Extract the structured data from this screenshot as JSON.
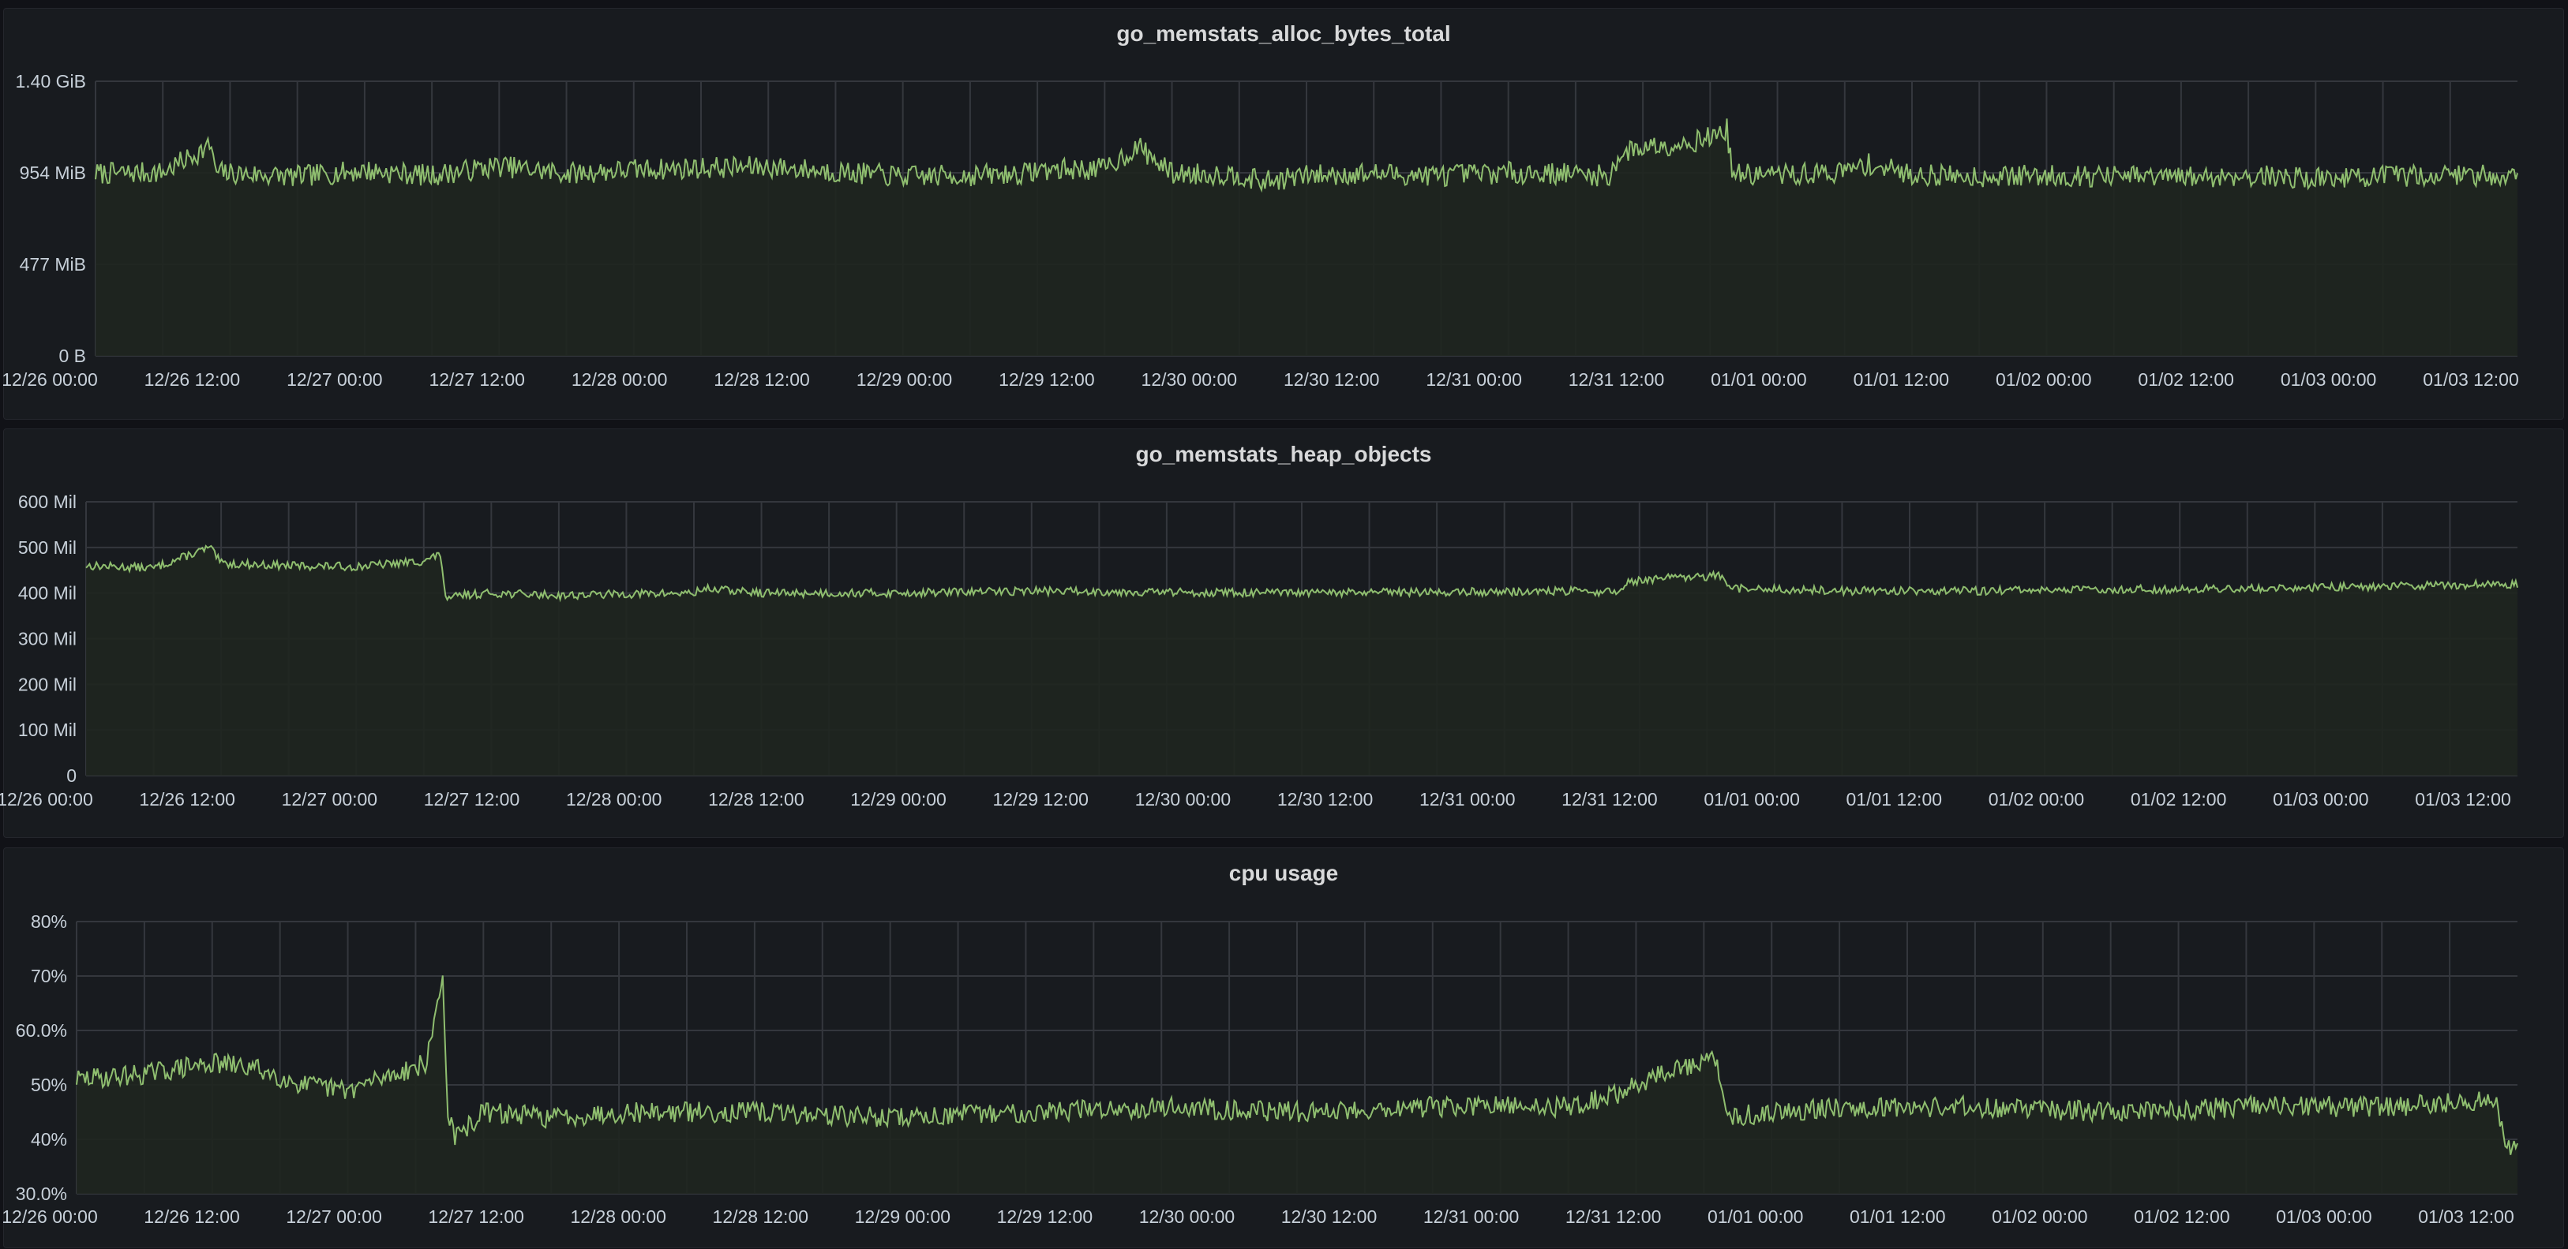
{
  "colors": {
    "background": "#111217",
    "panel": "#181b1f",
    "grid": "#34373d",
    "series_line": "#8fbe6f",
    "series_fill": "#1f261f",
    "text": "#c7d0d9",
    "title": "#d8d9da"
  },
  "panels": [
    {
      "title": "go_memstats_alloc_bytes_total"
    },
    {
      "title": "go_memstats_heap_objects"
    },
    {
      "title": "cpu usage"
    }
  ],
  "chart_data": [
    {
      "type": "area",
      "title": "go_memstats_alloc_bytes_total",
      "xlabel": "",
      "ylabel": "",
      "grid": true,
      "legend": "none",
      "x_range_hours": [
        0,
        216
      ],
      "x_tick_hours": [
        0,
        12,
        24,
        36,
        48,
        60,
        72,
        84,
        96,
        108,
        120,
        132,
        144,
        156,
        168,
        180,
        192,
        204
      ],
      "x_tick_labels": [
        "12/26 00:00",
        "12/26 12:00",
        "12/27 00:00",
        "12/27 12:00",
        "12/28 00:00",
        "12/28 12:00",
        "12/29 00:00",
        "12/29 12:00",
        "12/30 00:00",
        "12/30 12:00",
        "12/31 00:00",
        "12/31 12:00",
        "01/01 00:00",
        "01/01 12:00",
        "01/02 00:00",
        "01/02 12:00",
        "01/03 00:00",
        "01/03 12:00"
      ],
      "y_ticks": [
        0,
        477,
        954,
        1431
      ],
      "y_tick_labels": [
        "0 B",
        "477 MiB",
        "954 MiB",
        "1.40 GiB"
      ],
      "ylim": [
        0,
        1431
      ],
      "y_unit": "MiB",
      "series": [
        {
          "x": [
            0,
            6,
            10.4,
            10.6,
            12,
            18,
            24,
            30,
            36,
            42,
            48,
            54,
            60,
            66,
            72,
            78,
            83,
            84,
            90,
            93,
            96,
            102,
            104,
            108,
            114,
            120,
            126,
            132,
            135,
            136,
            138,
            140,
            142,
            144,
            145.5,
            146,
            152,
            156,
            158,
            162,
            168,
            174,
            180,
            186,
            192,
            198,
            204,
            210,
            215
          ],
          "values": [
            950,
            955,
            1100,
            960,
            950,
            935,
            965,
            940,
            990,
            950,
            970,
            980,
            985,
            960,
            935,
            940,
            950,
            970,
            975,
            1090,
            950,
            945,
            905,
            940,
            950,
            940,
            955,
            950,
            935,
            1050,
            1090,
            1100,
            1110,
            1140,
            1180,
            945,
            945,
            960,
            1000,
            945,
            935,
            940,
            935,
            930,
            940,
            925,
            935,
            945,
            940
          ]
        }
      ]
    },
    {
      "type": "area",
      "title": "go_memstats_heap_objects",
      "xlabel": "",
      "ylabel": "",
      "grid": true,
      "legend": "none",
      "x_range_hours": [
        0,
        216
      ],
      "x_tick_hours": [
        0,
        12,
        24,
        36,
        48,
        60,
        72,
        84,
        96,
        108,
        120,
        132,
        144,
        156,
        168,
        180,
        192,
        204
      ],
      "x_tick_labels": [
        "12/26 00:00",
        "12/26 12:00",
        "12/27 00:00",
        "12/27 12:00",
        "12/28 00:00",
        "12/28 12:00",
        "12/29 00:00",
        "12/29 12:00",
        "12/30 00:00",
        "12/30 12:00",
        "12/31 00:00",
        "12/31 12:00",
        "01/01 00:00",
        "01/01 12:00",
        "01/02 00:00",
        "01/02 12:00",
        "01/03 00:00",
        "01/03 12:00"
      ],
      "y_ticks": [
        0,
        100,
        200,
        300,
        400,
        500,
        600
      ],
      "y_tick_labels": [
        "0",
        "100 Mil",
        "200 Mil",
        "300 Mil",
        "400 Mil",
        "500 Mil",
        "600 Mil"
      ],
      "ylim": [
        0,
        600
      ],
      "y_unit": "Mil",
      "series": [
        {
          "x": [
            0,
            6,
            11,
            12,
            18,
            24,
            30,
            31.5,
            32,
            33,
            36,
            42,
            48,
            54,
            55,
            60,
            72,
            84,
            96,
            108,
            120,
            132,
            136,
            137,
            140,
            144,
            145,
            146,
            150,
            156,
            168,
            180,
            192,
            204,
            215
          ],
          "values": [
            460,
            455,
            500,
            465,
            460,
            458,
            470,
            485,
            380,
            395,
            400,
            395,
            398,
            400,
            410,
            400,
            400,
            405,
            402,
            400,
            402,
            404,
            402,
            425,
            432,
            435,
            440,
            410,
            408,
            405,
            405,
            408,
            410,
            415,
            420
          ]
        }
      ]
    },
    {
      "type": "line",
      "title": "cpu usage",
      "xlabel": "",
      "ylabel": "",
      "grid": true,
      "legend": "none",
      "x_range_hours": [
        0,
        216
      ],
      "x_tick_hours": [
        0,
        12,
        24,
        36,
        48,
        60,
        72,
        84,
        96,
        108,
        120,
        132,
        144,
        156,
        168,
        180,
        192,
        204
      ],
      "x_tick_labels": [
        "12/26 00:00",
        "12/26 12:00",
        "12/27 00:00",
        "12/27 12:00",
        "12/28 00:00",
        "12/28 12:00",
        "12/29 00:00",
        "12/29 12:00",
        "12/30 00:00",
        "12/30 12:00",
        "12/31 00:00",
        "12/31 12:00",
        "01/01 00:00",
        "01/01 12:00",
        "01/02 00:00",
        "01/02 12:00",
        "01/03 00:00",
        "01/03 12:00"
      ],
      "y_ticks": [
        30,
        40,
        50,
        60,
        70,
        80
      ],
      "y_tick_labels": [
        "30.0%",
        "40%",
        "50%",
        "60.0%",
        "70%",
        "80%"
      ],
      "ylim": [
        30,
        80
      ],
      "y_unit": "%",
      "series": [
        {
          "x": [
            0,
            6,
            12,
            16,
            20,
            24,
            28,
            31,
            32,
            32.4,
            32.8,
            33.5,
            36,
            42,
            48,
            60,
            72,
            84,
            96,
            108,
            120,
            132,
            136,
            140,
            144,
            145,
            146,
            150,
            156,
            168,
            180,
            192,
            204,
            214,
            215
          ],
          "values": [
            51,
            52,
            54,
            53,
            50,
            49,
            52,
            54,
            66,
            70,
            46,
            40,
            45,
            44,
            45,
            45,
            44,
            45,
            46,
            45,
            46,
            46,
            48,
            52,
            54,
            55,
            44,
            45,
            46,
            46,
            45,
            46,
            46,
            47,
            39
          ]
        }
      ]
    }
  ]
}
